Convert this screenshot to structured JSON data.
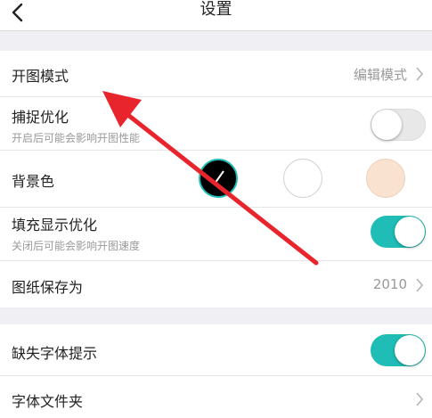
{
  "header": {
    "title": "设置"
  },
  "settings_group_1": {
    "open_mode": {
      "label": "开图模式",
      "value": "编辑模式"
    },
    "capture_optimize": {
      "label": "捕捉优化",
      "sublabel": "开启后可能会影响开图性能",
      "enabled": false
    },
    "background_color": {
      "label": "背景色",
      "options": [
        {
          "name": "black",
          "color": "#000000",
          "selected": true
        },
        {
          "name": "white",
          "color": "#ffffff",
          "selected": false
        },
        {
          "name": "beige",
          "color": "#f9e3d0",
          "selected": false
        }
      ]
    },
    "fill_display_optimize": {
      "label": "填充显示优化",
      "sublabel": "关闭后可能会影响开图速度",
      "enabled": true
    },
    "save_drawing_as": {
      "label": "图纸保存为",
      "value": "2010"
    }
  },
  "settings_group_2": {
    "missing_font_prompt": {
      "label": "缺失字体提示",
      "enabled": true
    },
    "font_folder": {
      "label": "字体文件夹"
    }
  },
  "colors": {
    "accent": "#1fbdb5",
    "annotation_arrow": "#e8252c",
    "background": "#efeff4"
  }
}
